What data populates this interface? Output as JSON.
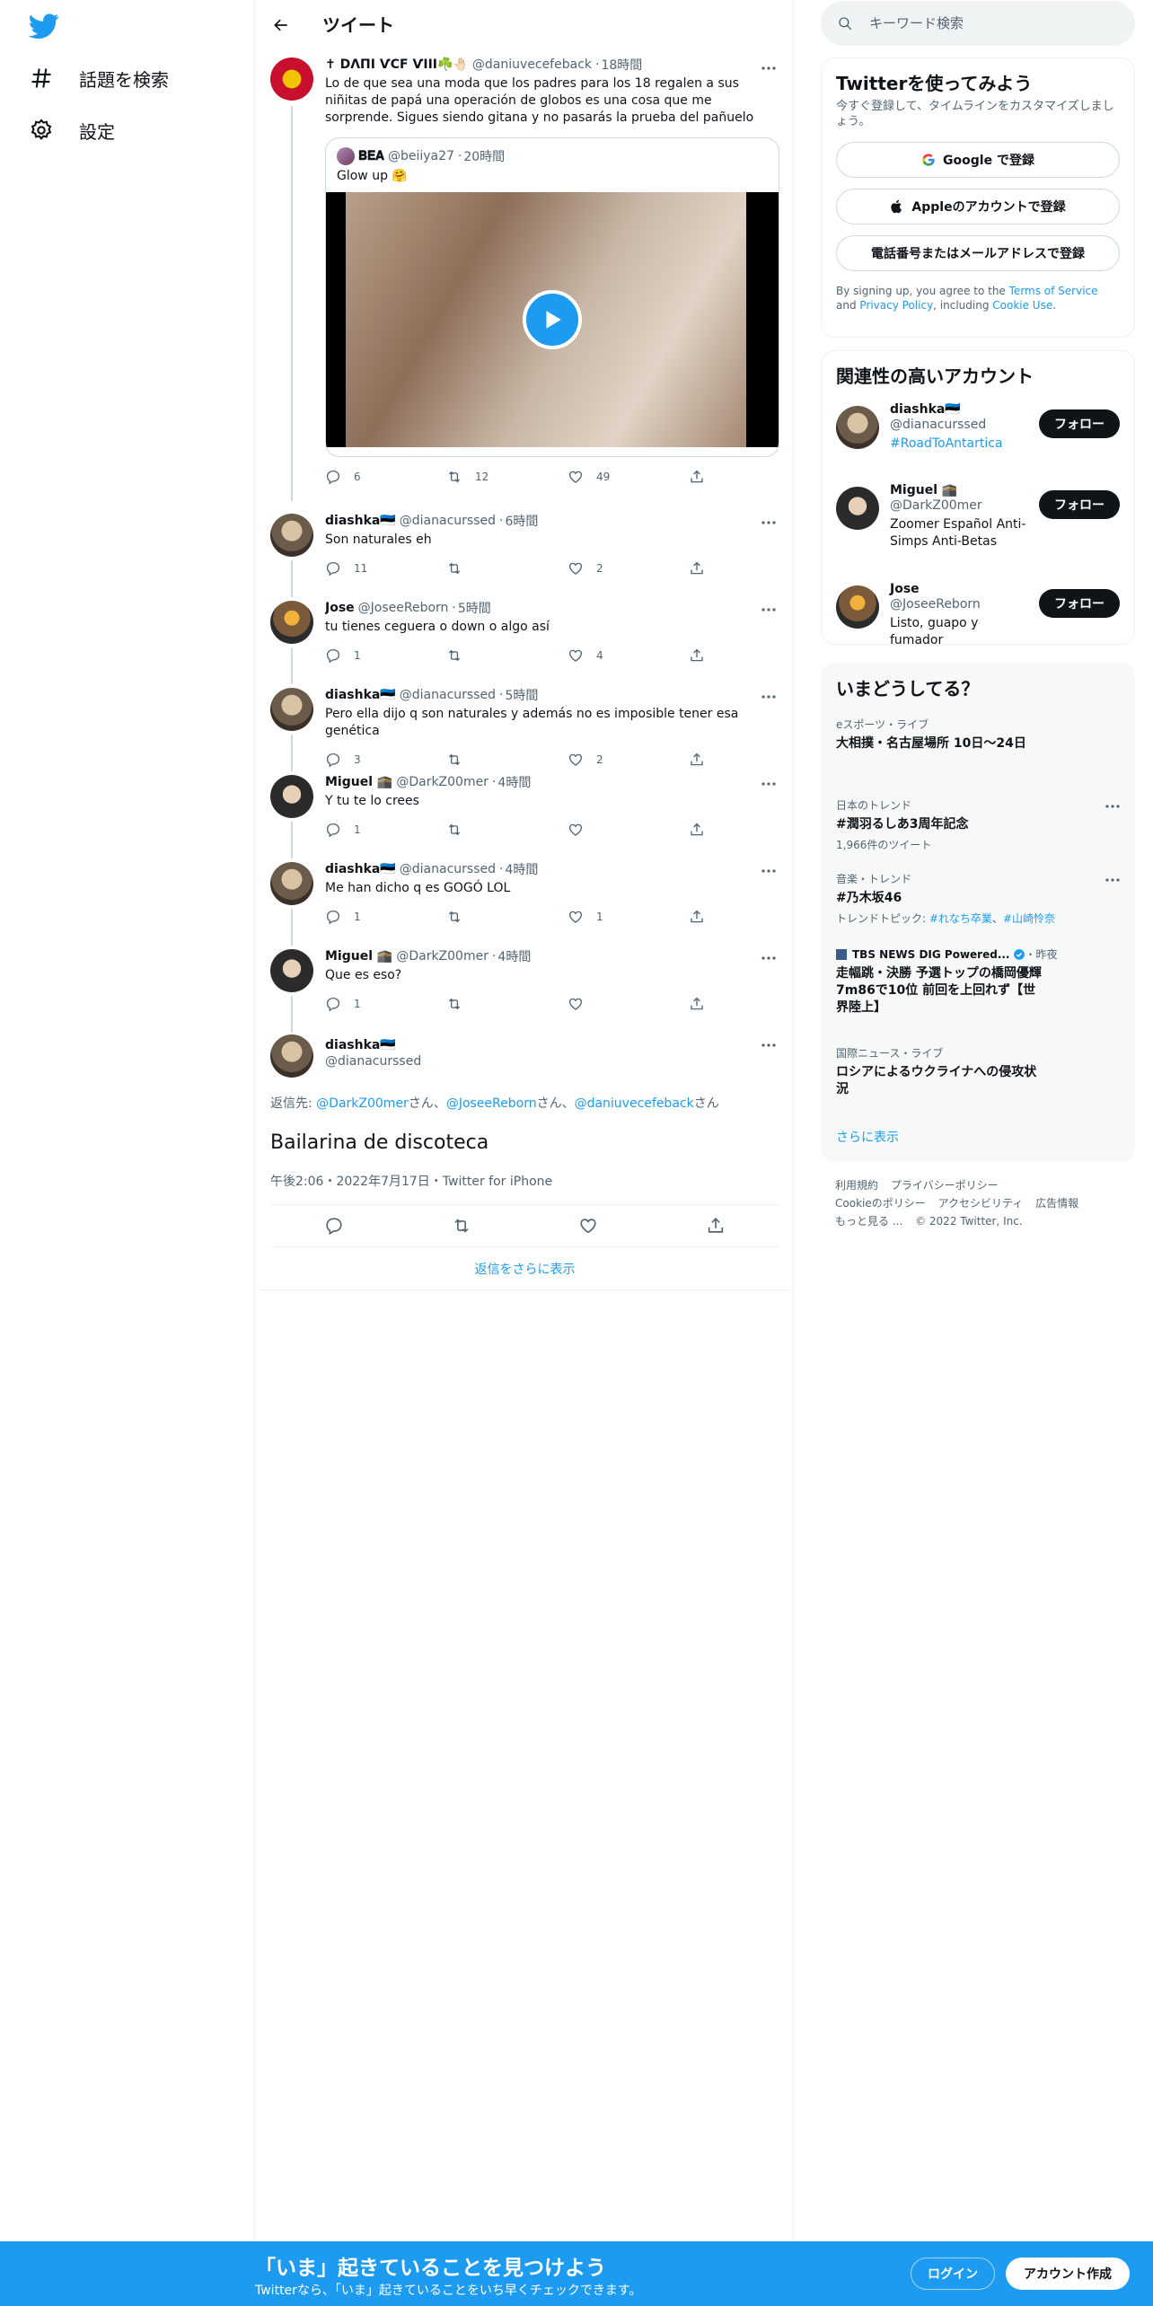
{
  "nav": {
    "explore_label": "話題を検索",
    "settings_label": "設定"
  },
  "header": {
    "title": "ツイート"
  },
  "main_tweet": {
    "name": "✝ DΛПI ѴСF ѴIII☘️🤚🏻",
    "handle": "@daniuvecefeback",
    "time": "18時間",
    "text": "Lo de que sea una moda que los padres para los 18 regalen a sus niñitas de papá una operación de globos es una cosa que me sorprende. Sigues siendo gitana y no pasarás la prueba del pañuelo",
    "quote": {
      "name": "𝐁𝐄𝐀",
      "handle": "@beiiya27",
      "time": "20時間",
      "text": "Glow up 🤗"
    },
    "replies": "6",
    "retweets": "12",
    "likes": "49"
  },
  "replies": [
    {
      "name": "diashka🇪🇪",
      "handle": "@dianacurssed",
      "time": "6時間",
      "text": "Son naturales eh",
      "replies": "11",
      "retweets": "",
      "likes": "2"
    },
    {
      "name": "Jose",
      "handle": "@JoseeReborn",
      "time": "5時間",
      "text": "tu tienes ceguera o down o algo así",
      "replies": "1",
      "retweets": "",
      "likes": "4"
    },
    {
      "name": "diashka🇪🇪",
      "handle": "@dianacurssed",
      "time": "5時間",
      "text": "Pero ella dijo q son naturales y además no es imposible tener esa genética",
      "replies": "3",
      "retweets": "",
      "likes": "2"
    },
    {
      "name": "Miguel 🕋",
      "handle": "@DarkZ00mer",
      "time": "4時間",
      "text": "Y tu te lo crees",
      "replies": "1",
      "retweets": "",
      "likes": ""
    },
    {
      "name": "diashka🇪🇪",
      "handle": "@dianacurssed",
      "time": "4時間",
      "text": "Me han dicho q es GOGÓ LOL",
      "replies": "1",
      "retweets": "",
      "likes": "1"
    },
    {
      "name": "Miguel 🕋",
      "handle": "@DarkZ00mer",
      "time": "4時間",
      "text": "Que es eso?",
      "replies": "1",
      "retweets": "",
      "likes": ""
    }
  ],
  "focus_tweet": {
    "name": "diashka🇪🇪",
    "handle": "@dianacurssed",
    "reply_prefix": "返信先: ",
    "reply_to": [
      "@DarkZ00mer",
      "@JoseeReborn",
      "@daniuvecefeback"
    ],
    "reply_suffix_san": "さん",
    "reply_sep": "、",
    "text": "Bailarina de discoteca",
    "meta": "午後2:06・2022年7月17日・Twitter for iPhone"
  },
  "show_more_replies": "返信をさらに表示",
  "search": {
    "placeholder": "キーワード検索"
  },
  "signup_card": {
    "title": "Twitterを使ってみよう",
    "subtitle": "今すぐ登録して、タイムラインをカスタマイズしましょう。",
    "google": "Google で登録",
    "apple": "Appleのアカウントで登録",
    "phone": "電話番号またはメールアドレスで登録",
    "tos_1": "By signing up, you agree to the ",
    "tos_link1": "Terms of Service",
    "tos_2": " and ",
    "tos_link2": "Privacy Policy",
    "tos_3": ", including ",
    "tos_link3": "Cookie Use",
    "tos_4": "."
  },
  "relevant": {
    "title": "関連性の高いアカウント",
    "follow_label": "フォロー",
    "accounts": [
      {
        "name": "diashka🇪🇪",
        "handle": "@dianacurssed",
        "bio": "#RoadToAntartica"
      },
      {
        "name": "Miguel 🕋",
        "handle": "@DarkZ00mer",
        "bio": "Zoomer Español Anti-Simps Anti-Betas"
      },
      {
        "name": "Jose",
        "handle": "@JoseeReborn",
        "bio": "Listo, guapo y fumador"
      }
    ]
  },
  "trends": {
    "title": "いまどうしてる？",
    "items": [
      {
        "meta": "eスポーツ・ライブ",
        "name": "大相撲・名古屋場所 10日〜24日",
        "sub": ""
      },
      {
        "meta": "日本のトレンド",
        "name": "#潤羽るしあ3周年記念",
        "sub": "1,966件のツイート"
      },
      {
        "meta": "音楽・トレンド",
        "name": "#乃木坂46",
        "sub_prefix": "トレンドトピック: ",
        "sub_links": [
          "#れなち卒業",
          "#山崎怜奈"
        ]
      },
      {
        "meta_source": "TBS NEWS DIG Powered...",
        "meta_time": "・昨夜",
        "name": "走幅跳・決勝 予選トップの橋岡優輝 7m86で10位 前回を上回れず【世界陸上】"
      },
      {
        "meta": "国際ニュース・ライブ",
        "name": "ロシアによるウクライナへの侵攻状況"
      }
    ],
    "show_more": "さらに表示"
  },
  "footer": {
    "links_row1": [
      "利用規約",
      "プライバシーポリシー"
    ],
    "links_row2": [
      "Cookieのポリシー",
      "アクセシビリティ",
      "広告情報"
    ],
    "more": "もっと見る ...",
    "copyright": "© 2022 Twitter, Inc."
  },
  "bottombar": {
    "title": "「いま」起きていることを見つけよう",
    "subtitle": "Twitterなら、「いま」起きていることをいち早くチェックできます。",
    "login": "ログイン",
    "signup": "アカウント作成"
  },
  "colors": {
    "accent": "#1d9bf0",
    "text": "#0f1419",
    "muted": "#536471"
  }
}
